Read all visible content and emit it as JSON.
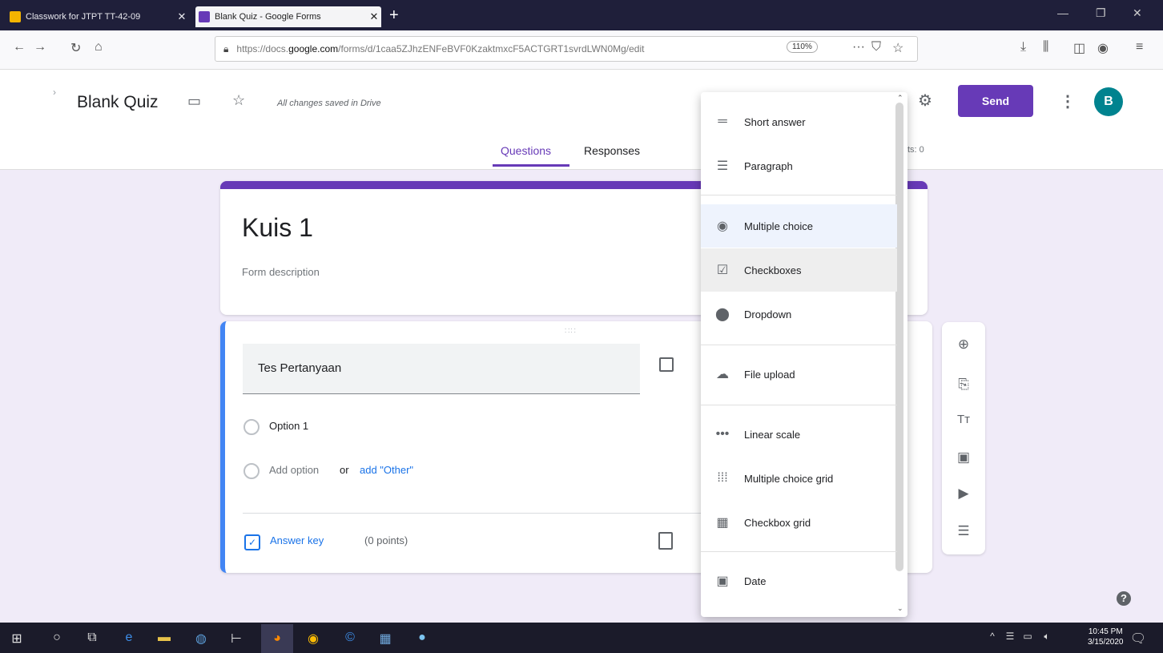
{
  "browser": {
    "tabs": [
      {
        "title": "Classwork for JTPT TT-42-09",
        "active": false
      },
      {
        "title": "Blank Quiz - Google Forms",
        "active": true
      }
    ],
    "url_prefix": "https://docs.",
    "url_domain": "google.com",
    "url_path": "/forms/d/1caa5ZJhzENFeBVF0KzaktmxcF5ACTGRT1svrdLWN0Mg/edit",
    "zoom": "110%"
  },
  "header": {
    "doc_title": "Blank Quiz",
    "save_status": "All changes saved in Drive",
    "send_label": "Send",
    "avatar_initial": "B",
    "tabs": [
      {
        "label": "Questions",
        "active": true
      },
      {
        "label": "Responses",
        "active": false
      }
    ],
    "total_points_fragment": "ts: 0"
  },
  "form": {
    "title": "Kuis 1",
    "description_placeholder": "Form description",
    "question": {
      "text": "Tes Pertanyaan",
      "option1": "Option 1",
      "add_option": "Add option",
      "or": "or",
      "add_other": "add \"Other\"",
      "answer_key": "Answer key",
      "points": "(0 points)"
    }
  },
  "question_type_menu": {
    "items": [
      {
        "label": "Short answer",
        "icon": "short-answer-icon"
      },
      {
        "label": "Paragraph",
        "icon": "paragraph-icon"
      },
      {
        "label": "Multiple choice",
        "icon": "radio-button-icon",
        "selected": true
      },
      {
        "label": "Checkboxes",
        "icon": "checkbox-icon",
        "hovered": true
      },
      {
        "label": "Dropdown",
        "icon": "dropdown-icon"
      },
      {
        "label": "File upload",
        "icon": "cloud-upload-icon"
      },
      {
        "label": "Linear scale",
        "icon": "linear-scale-icon"
      },
      {
        "label": "Multiple choice grid",
        "icon": "grid-dots-icon"
      },
      {
        "label": "Checkbox grid",
        "icon": "checkbox-grid-icon"
      },
      {
        "label": "Date",
        "icon": "calendar-icon"
      }
    ]
  },
  "taskbar": {
    "time": "10:45 PM",
    "date": "3/15/2020"
  },
  "colors": {
    "accent": "#673ab7",
    "question_border": "#4285f4",
    "link": "#1a73e8",
    "background": "#f0ebf8"
  }
}
